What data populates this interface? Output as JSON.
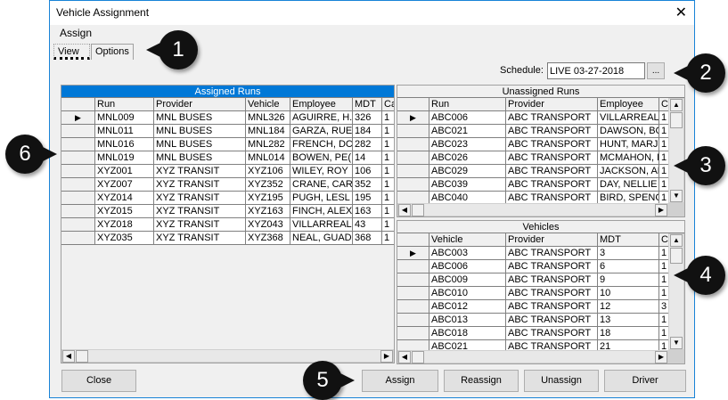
{
  "window": {
    "title": "Vehicle Assignment",
    "close_icon": "close-icon"
  },
  "menu": {
    "assign": "Assign"
  },
  "tabs": [
    {
      "label": "View",
      "active": true
    },
    {
      "label": "Options",
      "active": false
    }
  ],
  "schedule": {
    "label": "Schedule:",
    "value": "LIVE 03-27-2018",
    "browse": "..."
  },
  "assigned": {
    "title": "Assigned Runs",
    "header_color": "#0078d7",
    "columns": [
      "",
      "Run",
      "Provider",
      "Vehicle",
      "Employee",
      "MDT",
      "Ca"
    ],
    "rows": [
      [
        "MNL009",
        "MNL BUSES",
        "MNL326",
        "AGUIRRE, H.",
        "326",
        "1"
      ],
      [
        "MNL011",
        "MNL BUSES",
        "MNL184",
        "GARZA, RUE",
        "184",
        "1"
      ],
      [
        "MNL016",
        "MNL BUSES",
        "MNL282",
        "FRENCH, DC",
        "282",
        "1"
      ],
      [
        "MNL019",
        "MNL BUSES",
        "MNL014",
        "BOWEN, PE(",
        "14",
        "1"
      ],
      [
        "XYZ001",
        "XYZ TRANSIT",
        "XYZ106",
        "WILEY, ROY",
        "106",
        "1"
      ],
      [
        "XYZ007",
        "XYZ TRANSIT",
        "XYZ352",
        "CRANE, CAR",
        "352",
        "1"
      ],
      [
        "XYZ014",
        "XYZ TRANSIT",
        "XYZ195",
        "PUGH, LESL",
        "195",
        "1"
      ],
      [
        "XYZ015",
        "XYZ TRANSIT",
        "XYZ163",
        "FINCH, ALEX",
        "163",
        "1"
      ],
      [
        "XYZ018",
        "XYZ TRANSIT",
        "XYZ043",
        "VILLARREAL",
        "43",
        "1"
      ],
      [
        "XYZ035",
        "XYZ TRANSIT",
        "XYZ368",
        "NEAL, GUAD",
        "368",
        "1"
      ]
    ]
  },
  "unassigned": {
    "title": "Unassigned Runs",
    "columns": [
      "",
      "Run",
      "Provider",
      "Employee",
      "C"
    ],
    "rows": [
      [
        "ABC006",
        "ABC TRANSPORT",
        "VILLARREAL,",
        "1"
      ],
      [
        "ABC021",
        "ABC TRANSPORT",
        "DAWSON, BC",
        "1"
      ],
      [
        "ABC023",
        "ABC TRANSPORT",
        "HUNT, MARJ",
        "1"
      ],
      [
        "ABC026",
        "ABC TRANSPORT",
        "MCMAHON, D",
        "1"
      ],
      [
        "ABC029",
        "ABC TRANSPORT",
        "JACKSON, AL",
        "1"
      ],
      [
        "ABC039",
        "ABC TRANSPORT",
        "DAY, NELLIE",
        "1"
      ],
      [
        "ABC040",
        "ABC TRANSPORT",
        "BIRD, SPENC",
        "1"
      ]
    ]
  },
  "vehicles": {
    "title": "Vehicles",
    "columns": [
      "",
      "Vehicle",
      "Provider",
      "MDT",
      "C"
    ],
    "rows": [
      [
        "ABC003",
        "ABC TRANSPORT",
        "3",
        "1"
      ],
      [
        "ABC006",
        "ABC TRANSPORT",
        "6",
        "1"
      ],
      [
        "ABC009",
        "ABC TRANSPORT",
        "9",
        "1"
      ],
      [
        "ABC010",
        "ABC TRANSPORT",
        "10",
        "1"
      ],
      [
        "ABC012",
        "ABC TRANSPORT",
        "12",
        "3"
      ],
      [
        "ABC013",
        "ABC TRANSPORT",
        "13",
        "1"
      ],
      [
        "ABC018",
        "ABC TRANSPORT",
        "18",
        "1"
      ],
      [
        "ABC021",
        "ABC TRANSPORT",
        "21",
        "1"
      ]
    ]
  },
  "buttons": {
    "close": "Close",
    "assign": "Assign",
    "reassign": "Reassign",
    "unassign": "Unassign",
    "driver": "Driver"
  },
  "callouts": [
    "1",
    "2",
    "3",
    "4",
    "5",
    "6"
  ]
}
